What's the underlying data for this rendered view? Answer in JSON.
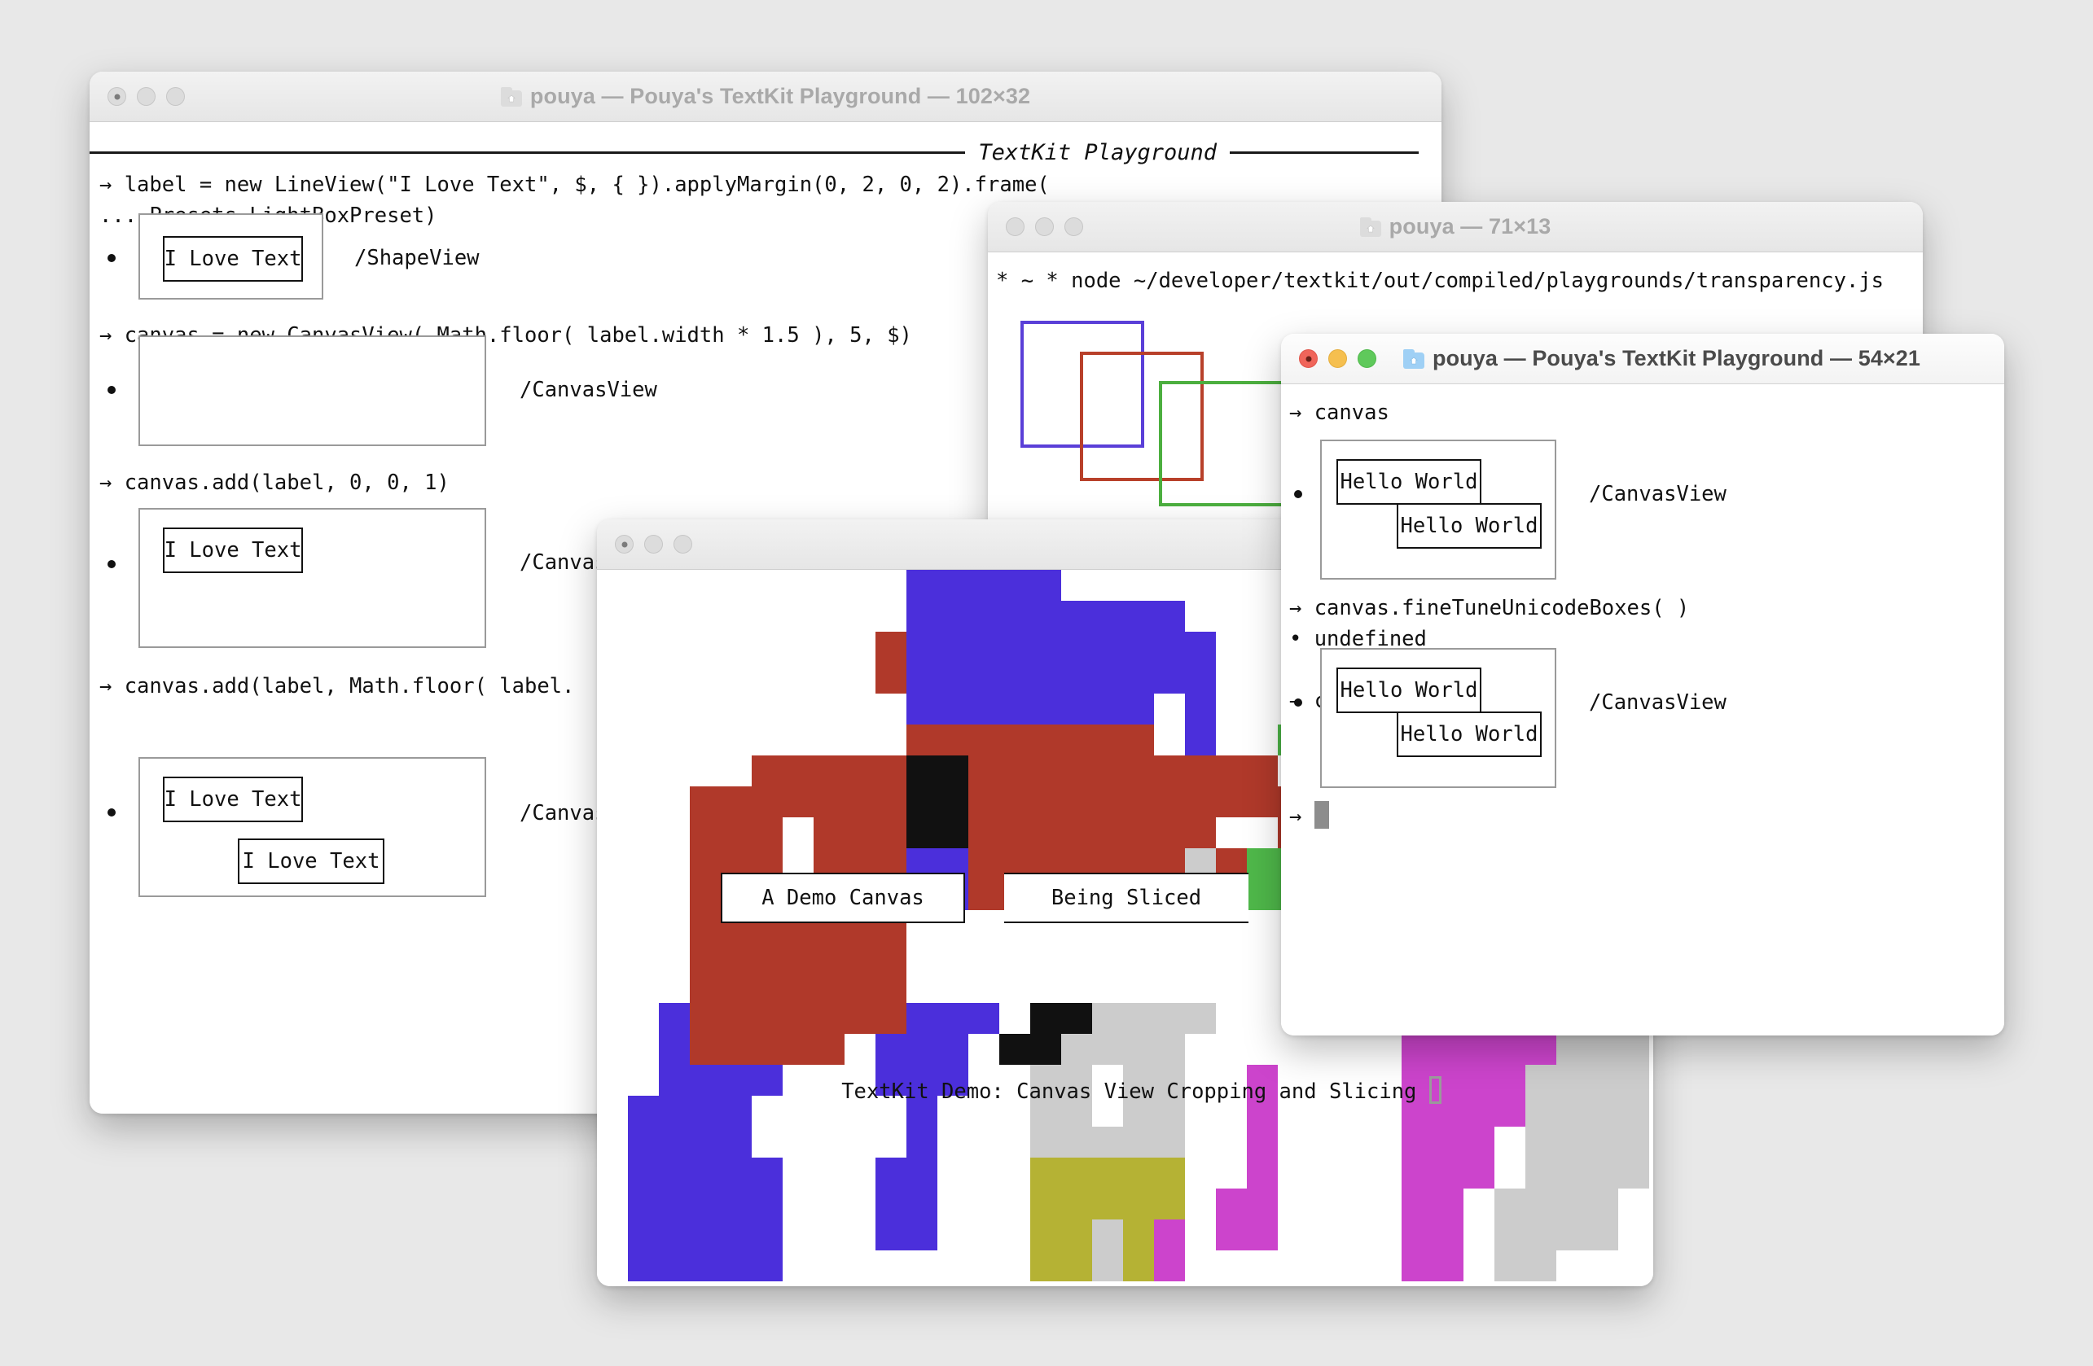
{
  "windows": {
    "playground_main": {
      "title": "pouya — Pouya's TextKit Playground — 102×32",
      "header_label": "TextKit Playground",
      "lines": {
        "l1": "→ label = new LineView(\"I Love Text\", $, { }).applyMargin(0, 2, 0, 2).frame(",
        "l2": "... Presets.LightBoxPreset)",
        "l3": "→ canvas = new CanvasView( Math.floor( label.width * 1.5 ), 5, $)",
        "l4": "→ canvas.add(label, 0, 0, 1)",
        "l5": "→ canvas.add(label, Math.floor( label."
      },
      "results": {
        "r1_type": "/ShapeView",
        "r2_type": "/CanvasView",
        "r3_type": "/CanvasV",
        "r4_type": "/CanvasV"
      },
      "label_text": "I Love Text"
    },
    "node_terminal": {
      "title": "pouya — 71×13",
      "command": "* ~ * node ~/developer/textkit/out/compiled/playgrounds/transparency.js",
      "prompt": "* ~ *",
      "rects": [
        {
          "name": "blue-rect",
          "color": "#5a3fd8"
        },
        {
          "name": "red-rect",
          "color": "#b8402a"
        },
        {
          "name": "green-rect",
          "color": "#4caf3f"
        }
      ]
    },
    "pixel_demo": {
      "caption": "TextKit Demo: Canvas View Cropping and Slicing",
      "label_left": "A Demo Canvas",
      "label_right": "Being Sliced"
    },
    "playground_active": {
      "title": "pouya — Pouya's TextKit Playground — 54×21",
      "lines": {
        "l1": "→ canvas",
        "l2": "→ canvas.fineTuneUnicodeBoxes( )",
        "l3": "• undefined",
        "l4": "→ canvas",
        "l5": "→"
      },
      "results": {
        "r1_type": "/CanvasView",
        "r2_type": "/CanvasView"
      },
      "hello_text": "Hello World"
    }
  },
  "palette": {
    "blue": "#4b2fdb",
    "brick": "#b0392a",
    "green": "#4fb84a",
    "magenta": "#cc44cc",
    "gray": "#cccccc",
    "olive": "#b5b234",
    "black": "#111111"
  }
}
